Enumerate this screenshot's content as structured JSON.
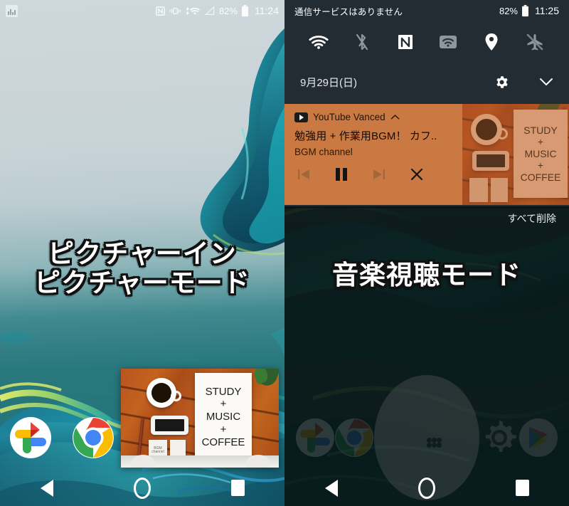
{
  "left_panel": {
    "status_bar": {
      "notification_icon": "screenshot-image-icon",
      "icons": [
        "nfc-icon",
        "vibrate-icon",
        "wifi-icon",
        "signal-no-service-icon"
      ],
      "battery_percent": "82%",
      "battery_icon": "battery-full-icon",
      "time": "11:24"
    },
    "overlay_label": "ピクチャーイン\nピクチャーモード",
    "overlay_label_line1": "ピクチャーイン",
    "overlay_label_line2": "ピクチャーモード",
    "pip_window": {
      "name": "picture-in-picture-window",
      "poster_lines": [
        "STUDY",
        "+",
        "MUSIC",
        "+",
        "COFFEE"
      ],
      "note_card_text": "BGM\nchannel"
    },
    "dock": [
      {
        "label": "Google Photos",
        "icon": "google-photos-icon"
      },
      {
        "label": "Chrome",
        "icon": "chrome-icon"
      }
    ],
    "navbar": [
      {
        "label": "戻る",
        "icon": "back-triangle-icon"
      },
      {
        "label": "ホーム",
        "icon": "home-circle-icon"
      },
      {
        "label": "履歴",
        "icon": "recents-square-icon"
      }
    ]
  },
  "right_panel": {
    "status_bar": {
      "carrier_text": "通信サービスはありません",
      "battery_percent": "82%",
      "battery_icon": "battery-full-icon",
      "time": "11:25"
    },
    "quick_settings": [
      {
        "name": "wifi-tile",
        "icon": "wifi-icon",
        "state": "on"
      },
      {
        "name": "bluetooth-tile",
        "icon": "bluetooth-off-icon",
        "state": "off"
      },
      {
        "name": "nfc-tile",
        "icon": "nfc-icon",
        "state": "on"
      },
      {
        "name": "hotspot-tile",
        "icon": "hotspot-icon",
        "state": "on"
      },
      {
        "name": "location-tile",
        "icon": "location-pin-icon",
        "state": "on"
      },
      {
        "name": "airplane-tile",
        "icon": "airplane-off-icon",
        "state": "off"
      }
    ],
    "date_row": {
      "date": "9月29日(日)",
      "settings_icon": "gear-icon",
      "expand_icon": "chevron-down-icon"
    },
    "notification": {
      "app_name": "YouTube Vanced",
      "app_icon": "youtube-icon",
      "collapse_icon": "chevron-up-icon",
      "title": "勉強用 + 作業用BGM！ カフ..",
      "subtitle": "BGM channel",
      "controls": [
        {
          "name": "previous-button",
          "icon": "skip-previous-icon",
          "active": false
        },
        {
          "name": "pause-button",
          "icon": "pause-icon",
          "active": true
        },
        {
          "name": "next-button",
          "icon": "skip-next-icon",
          "active": false
        },
        {
          "name": "dismiss-button",
          "icon": "close-x-icon",
          "active": true
        }
      ],
      "artwork_lines": [
        "STUDY",
        "+",
        "MUSIC",
        "+",
        "COFFEE"
      ],
      "background_color": "#cb7942"
    },
    "clear_all_label": "すべて削除",
    "overlay_label": "音楽視聴モード",
    "dock": [
      {
        "label": "Google Photos",
        "icon": "google-photos-icon"
      },
      {
        "label": "Chrome",
        "icon": "chrome-icon"
      },
      {
        "label": "アプリ一覧",
        "icon": "app-drawer-icon"
      },
      {
        "label": "設定",
        "icon": "gear-icon"
      },
      {
        "label": "Play ストア",
        "icon": "play-store-icon"
      }
    ],
    "navbar": [
      {
        "label": "戻る",
        "icon": "back-triangle-icon"
      },
      {
        "label": "ホーム",
        "icon": "home-circle-icon"
      },
      {
        "label": "履歴",
        "icon": "recents-square-icon"
      }
    ]
  },
  "colors": {
    "notification_orange": "#cb7942",
    "shade_dark": "#232c33",
    "wallpaper_teal": "#1f6f76",
    "wallpaper_sky": "#cfd8dc"
  }
}
